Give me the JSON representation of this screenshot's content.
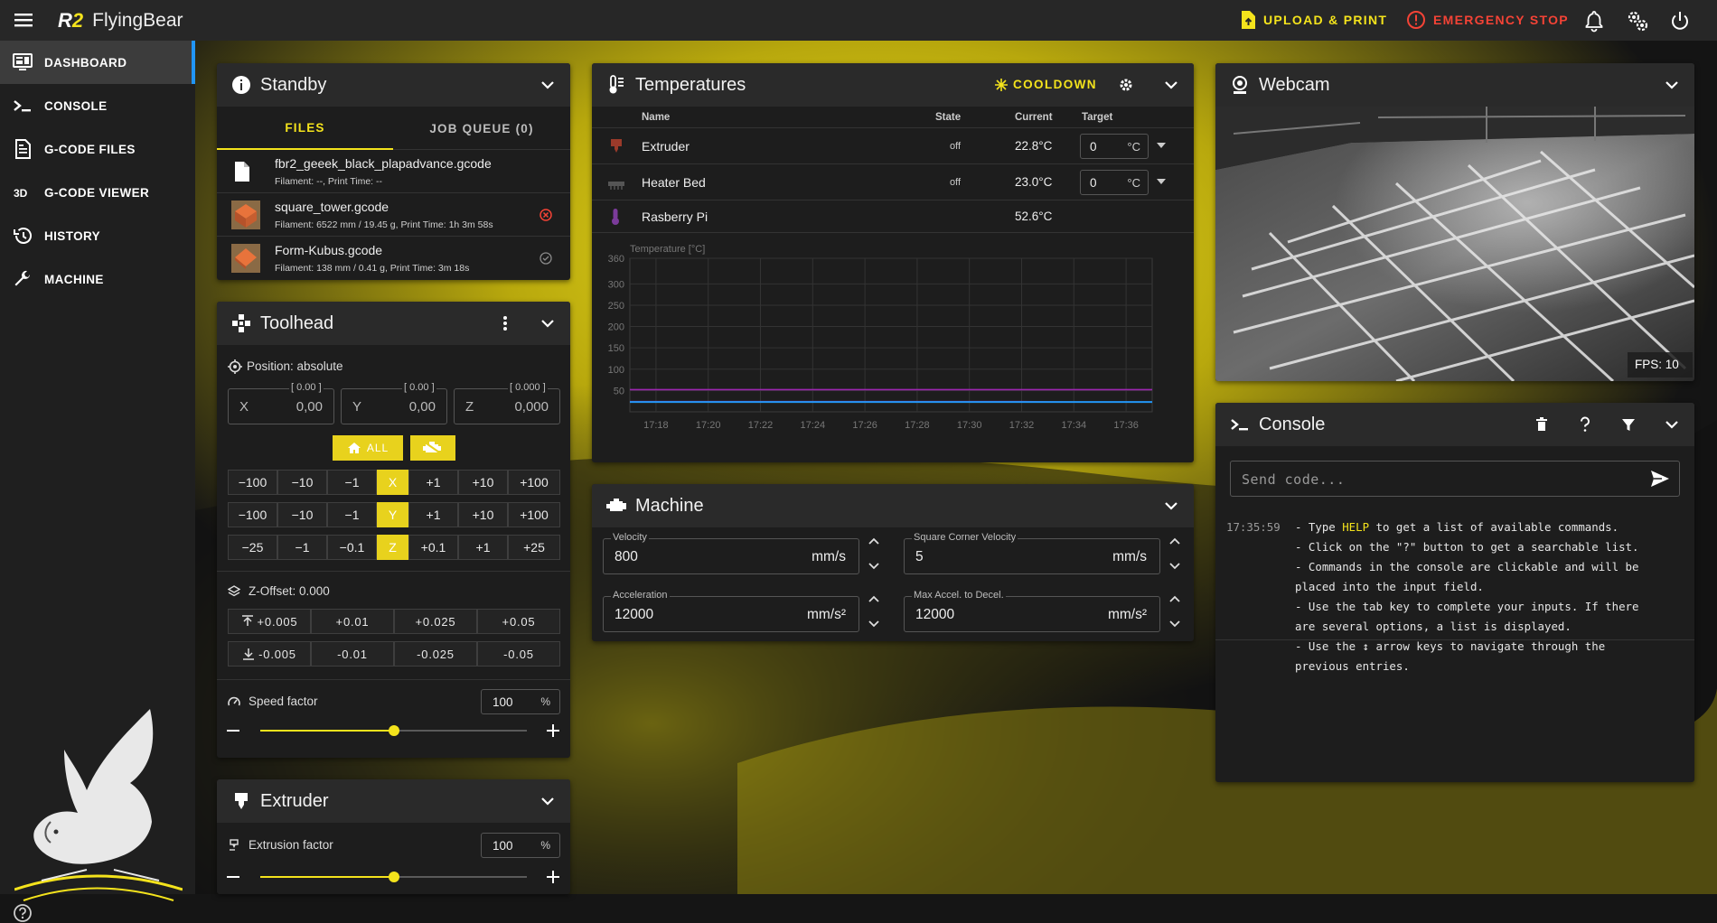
{
  "app": {
    "brand_short": "R2",
    "brand_name": "FlyingBear"
  },
  "topbar": {
    "upload_print": "UPLOAD & PRINT",
    "emergency_stop": "EMERGENCY STOP"
  },
  "sidebar": {
    "items": [
      {
        "label": "DASHBOARD",
        "icon": "monitor-dashboard-icon"
      },
      {
        "label": "CONSOLE",
        "icon": "console-prompt-icon"
      },
      {
        "label": "G-CODE FILES",
        "icon": "file-document-icon"
      },
      {
        "label": "G-CODE VIEWER",
        "icon": "3d-icon"
      },
      {
        "label": "HISTORY",
        "icon": "history-icon"
      },
      {
        "label": "MACHINE",
        "icon": "wrench-icon"
      }
    ]
  },
  "standby": {
    "title": "Standby",
    "tabs": [
      "FILES",
      "JOB QUEUE (0)"
    ],
    "files": [
      {
        "name": "fbr2_geeek_black_plapadvance.gcode",
        "meta": "Filament: --, Print Time: --",
        "status": ""
      },
      {
        "name": "square_tower.gcode",
        "meta": "Filament: 6522 mm / 19.45 g, Print Time: 1h 3m 58s",
        "status": "cancelled"
      },
      {
        "name": "Form-Kubus.gcode",
        "meta": "Filament: 138 mm / 0.41 g, Print Time: 3m 18s",
        "status": "completed"
      }
    ]
  },
  "toolhead": {
    "title": "Toolhead",
    "position_label": "Position: absolute",
    "axes": [
      {
        "label": "X",
        "value": "0,00",
        "hint": "[ 0.00 ]"
      },
      {
        "label": "Y",
        "value": "0,00",
        "hint": "[ 0.00 ]"
      },
      {
        "label": "Z",
        "value": "0,000",
        "hint": "[ 0.000 ]"
      }
    ],
    "home_all": "ALL",
    "jog_x": [
      "−100",
      "−10",
      "−1",
      "X",
      "+1",
      "+10",
      "+100"
    ],
    "jog_y": [
      "−100",
      "−10",
      "−1",
      "Y",
      "+1",
      "+10",
      "+100"
    ],
    "jog_z": [
      "−25",
      "−1",
      "−0.1",
      "Z",
      "+0.1",
      "+1",
      "+25"
    ],
    "z_offset_label": "Z-Offset: 0.000",
    "zoff_up": [
      "+0.005",
      "+0.01",
      "+0.025",
      "+0.05"
    ],
    "zoff_down": [
      "-0.005",
      "-0.01",
      "-0.025",
      "-0.05"
    ],
    "speed_label": "Speed factor",
    "speed_value": "100",
    "speed_unit": "%",
    "speed_slider_fraction": 0.5
  },
  "extruder": {
    "title": "Extruder",
    "factor_label": "Extrusion factor",
    "factor_value": "100",
    "factor_unit": "%",
    "slider_fraction": 0.5
  },
  "temperatures": {
    "title": "Temperatures",
    "cooldown": "COOLDOWN",
    "headers": [
      "Name",
      "State",
      "Current",
      "Target"
    ],
    "rows": [
      {
        "name": "Extruder",
        "state": "off",
        "current": "22.8°C",
        "target": "0",
        "unit": "°C"
      },
      {
        "name": "Heater Bed",
        "state": "off",
        "current": "23.0°C",
        "target": "0",
        "unit": "°C"
      },
      {
        "name": "Rasberry Pi",
        "state": "",
        "current": "52.6°C",
        "target": "",
        "unit": ""
      }
    ]
  },
  "chart_data": {
    "type": "line",
    "ylabel": "Temperature [°C]",
    "ylim": [
      0,
      360
    ],
    "yticks": [
      "360",
      "300",
      "250",
      "200",
      "150",
      "100",
      "50"
    ],
    "x": [
      "17:18",
      "17:20",
      "17:22",
      "17:24",
      "17:26",
      "17:28",
      "17:30",
      "17:32",
      "17:34",
      "17:36"
    ],
    "grid": true,
    "series": [
      {
        "values": [
          24,
          24,
          24,
          24,
          24,
          24,
          24,
          24,
          23,
          23
        ],
        "color": "#9c27b0"
      },
      {
        "values": [
          52,
          52,
          52,
          52,
          52,
          52,
          52,
          52,
          52,
          52
        ],
        "color": "#9c27b0"
      },
      {
        "values": [
          23,
          23,
          23,
          23,
          23,
          23,
          23,
          23,
          23,
          23
        ],
        "color": "#2196f3"
      }
    ]
  },
  "machine": {
    "title": "Machine",
    "fields": [
      {
        "label": "Velocity",
        "value": "800",
        "unit": "mm/s"
      },
      {
        "label": "Square Corner Velocity",
        "value": "5",
        "unit": "mm/s"
      },
      {
        "label": "Acceleration",
        "value": "12000",
        "unit": "mm/s²"
      },
      {
        "label": "Max Accel. to Decel.",
        "value": "12000",
        "unit": "mm/s²"
      }
    ]
  },
  "webcam": {
    "title": "Webcam",
    "fps": "FPS: 10"
  },
  "console": {
    "title": "Console",
    "placeholder": "Send code...",
    "timestamp": "17:35:59",
    "help_pre": "- Type ",
    "help_keyword": "HELP",
    "help_post": " to get a list of available commands.",
    "lines": [
      "- Click on the \"?\" button to get a searchable list.",
      "- Commands in the console are clickable and will be",
      "placed into the input field.",
      "- Use the tab key to complete your inputs. If there",
      "are several options, a list is displayed.",
      "- Use the ↕ arrow keys to navigate through the",
      "previous entries."
    ]
  },
  "colors": {
    "accent": "#f4e31c",
    "error": "#f44336",
    "dashboard_active": "#2196f3"
  }
}
